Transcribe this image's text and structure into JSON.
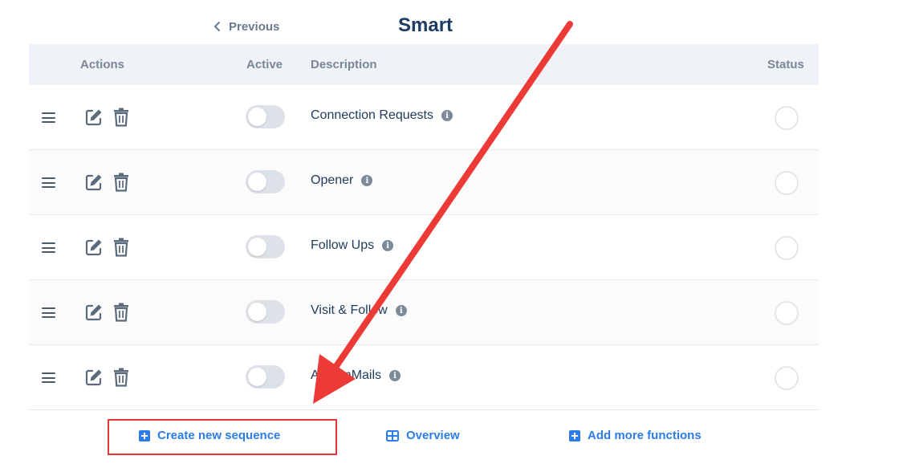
{
  "header": {
    "previous_label": "Previous",
    "title": "Smart"
  },
  "table": {
    "columns": {
      "actions": "Actions",
      "active": "Active",
      "description": "Description",
      "status": "Status"
    },
    "rows": [
      {
        "description": "Connection Requests",
        "active": false
      },
      {
        "description": "Opener",
        "active": false
      },
      {
        "description": "Follow Ups",
        "active": false
      },
      {
        "description": "Visit & Follow",
        "active": false
      },
      {
        "description": "Auto InMails",
        "active": false
      }
    ]
  },
  "footer": {
    "create_label": "Create new sequence",
    "overview_label": "Overview",
    "add_more_label": "Add more functions"
  },
  "colors": {
    "accent": "#2b7de9",
    "title": "#1c3b63",
    "annotation": "#e53935"
  }
}
